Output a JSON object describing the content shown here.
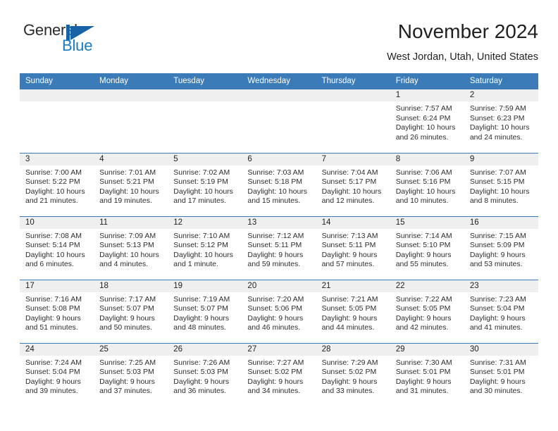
{
  "brand": {
    "name_part1": "General",
    "name_part2": "Blue",
    "logo_icon": "triangle-flag-icon",
    "accent_color": "#1763a6"
  },
  "header": {
    "month_title": "November 2024",
    "location": "West Jordan, Utah, United States"
  },
  "calendar": {
    "header_bg": "#3b7cb8",
    "daynum_bg": "#efefef",
    "weekday_headers": [
      "Sunday",
      "Monday",
      "Tuesday",
      "Wednesday",
      "Thursday",
      "Friday",
      "Saturday"
    ],
    "weeks": [
      [
        {
          "day": "",
          "empty": true,
          "sunrise": "",
          "sunset": "",
          "daylight1": "",
          "daylight2": ""
        },
        {
          "day": "",
          "empty": true,
          "sunrise": "",
          "sunset": "",
          "daylight1": "",
          "daylight2": ""
        },
        {
          "day": "",
          "empty": true,
          "sunrise": "",
          "sunset": "",
          "daylight1": "",
          "daylight2": ""
        },
        {
          "day": "",
          "empty": true,
          "sunrise": "",
          "sunset": "",
          "daylight1": "",
          "daylight2": ""
        },
        {
          "day": "",
          "empty": true,
          "sunrise": "",
          "sunset": "",
          "daylight1": "",
          "daylight2": ""
        },
        {
          "day": "1",
          "empty": false,
          "sunrise": "Sunrise: 7:57 AM",
          "sunset": "Sunset: 6:24 PM",
          "daylight1": "Daylight: 10 hours",
          "daylight2": "and 26 minutes."
        },
        {
          "day": "2",
          "empty": false,
          "sunrise": "Sunrise: 7:59 AM",
          "sunset": "Sunset: 6:23 PM",
          "daylight1": "Daylight: 10 hours",
          "daylight2": "and 24 minutes."
        }
      ],
      [
        {
          "day": "3",
          "empty": false,
          "sunrise": "Sunrise: 7:00 AM",
          "sunset": "Sunset: 5:22 PM",
          "daylight1": "Daylight: 10 hours",
          "daylight2": "and 21 minutes."
        },
        {
          "day": "4",
          "empty": false,
          "sunrise": "Sunrise: 7:01 AM",
          "sunset": "Sunset: 5:21 PM",
          "daylight1": "Daylight: 10 hours",
          "daylight2": "and 19 minutes."
        },
        {
          "day": "5",
          "empty": false,
          "sunrise": "Sunrise: 7:02 AM",
          "sunset": "Sunset: 5:19 PM",
          "daylight1": "Daylight: 10 hours",
          "daylight2": "and 17 minutes."
        },
        {
          "day": "6",
          "empty": false,
          "sunrise": "Sunrise: 7:03 AM",
          "sunset": "Sunset: 5:18 PM",
          "daylight1": "Daylight: 10 hours",
          "daylight2": "and 15 minutes."
        },
        {
          "day": "7",
          "empty": false,
          "sunrise": "Sunrise: 7:04 AM",
          "sunset": "Sunset: 5:17 PM",
          "daylight1": "Daylight: 10 hours",
          "daylight2": "and 12 minutes."
        },
        {
          "day": "8",
          "empty": false,
          "sunrise": "Sunrise: 7:06 AM",
          "sunset": "Sunset: 5:16 PM",
          "daylight1": "Daylight: 10 hours",
          "daylight2": "and 10 minutes."
        },
        {
          "day": "9",
          "empty": false,
          "sunrise": "Sunrise: 7:07 AM",
          "sunset": "Sunset: 5:15 PM",
          "daylight1": "Daylight: 10 hours",
          "daylight2": "and 8 minutes."
        }
      ],
      [
        {
          "day": "10",
          "empty": false,
          "sunrise": "Sunrise: 7:08 AM",
          "sunset": "Sunset: 5:14 PM",
          "daylight1": "Daylight: 10 hours",
          "daylight2": "and 6 minutes."
        },
        {
          "day": "11",
          "empty": false,
          "sunrise": "Sunrise: 7:09 AM",
          "sunset": "Sunset: 5:13 PM",
          "daylight1": "Daylight: 10 hours",
          "daylight2": "and 4 minutes."
        },
        {
          "day": "12",
          "empty": false,
          "sunrise": "Sunrise: 7:10 AM",
          "sunset": "Sunset: 5:12 PM",
          "daylight1": "Daylight: 10 hours",
          "daylight2": "and 1 minute."
        },
        {
          "day": "13",
          "empty": false,
          "sunrise": "Sunrise: 7:12 AM",
          "sunset": "Sunset: 5:11 PM",
          "daylight1": "Daylight: 9 hours",
          "daylight2": "and 59 minutes."
        },
        {
          "day": "14",
          "empty": false,
          "sunrise": "Sunrise: 7:13 AM",
          "sunset": "Sunset: 5:11 PM",
          "daylight1": "Daylight: 9 hours",
          "daylight2": "and 57 minutes."
        },
        {
          "day": "15",
          "empty": false,
          "sunrise": "Sunrise: 7:14 AM",
          "sunset": "Sunset: 5:10 PM",
          "daylight1": "Daylight: 9 hours",
          "daylight2": "and 55 minutes."
        },
        {
          "day": "16",
          "empty": false,
          "sunrise": "Sunrise: 7:15 AM",
          "sunset": "Sunset: 5:09 PM",
          "daylight1": "Daylight: 9 hours",
          "daylight2": "and 53 minutes."
        }
      ],
      [
        {
          "day": "17",
          "empty": false,
          "sunrise": "Sunrise: 7:16 AM",
          "sunset": "Sunset: 5:08 PM",
          "daylight1": "Daylight: 9 hours",
          "daylight2": "and 51 minutes."
        },
        {
          "day": "18",
          "empty": false,
          "sunrise": "Sunrise: 7:17 AM",
          "sunset": "Sunset: 5:07 PM",
          "daylight1": "Daylight: 9 hours",
          "daylight2": "and 50 minutes."
        },
        {
          "day": "19",
          "empty": false,
          "sunrise": "Sunrise: 7:19 AM",
          "sunset": "Sunset: 5:07 PM",
          "daylight1": "Daylight: 9 hours",
          "daylight2": "and 48 minutes."
        },
        {
          "day": "20",
          "empty": false,
          "sunrise": "Sunrise: 7:20 AM",
          "sunset": "Sunset: 5:06 PM",
          "daylight1": "Daylight: 9 hours",
          "daylight2": "and 46 minutes."
        },
        {
          "day": "21",
          "empty": false,
          "sunrise": "Sunrise: 7:21 AM",
          "sunset": "Sunset: 5:05 PM",
          "daylight1": "Daylight: 9 hours",
          "daylight2": "and 44 minutes."
        },
        {
          "day": "22",
          "empty": false,
          "sunrise": "Sunrise: 7:22 AM",
          "sunset": "Sunset: 5:05 PM",
          "daylight1": "Daylight: 9 hours",
          "daylight2": "and 42 minutes."
        },
        {
          "day": "23",
          "empty": false,
          "sunrise": "Sunrise: 7:23 AM",
          "sunset": "Sunset: 5:04 PM",
          "daylight1": "Daylight: 9 hours",
          "daylight2": "and 41 minutes."
        }
      ],
      [
        {
          "day": "24",
          "empty": false,
          "sunrise": "Sunrise: 7:24 AM",
          "sunset": "Sunset: 5:04 PM",
          "daylight1": "Daylight: 9 hours",
          "daylight2": "and 39 minutes."
        },
        {
          "day": "25",
          "empty": false,
          "sunrise": "Sunrise: 7:25 AM",
          "sunset": "Sunset: 5:03 PM",
          "daylight1": "Daylight: 9 hours",
          "daylight2": "and 37 minutes."
        },
        {
          "day": "26",
          "empty": false,
          "sunrise": "Sunrise: 7:26 AM",
          "sunset": "Sunset: 5:03 PM",
          "daylight1": "Daylight: 9 hours",
          "daylight2": "and 36 minutes."
        },
        {
          "day": "27",
          "empty": false,
          "sunrise": "Sunrise: 7:27 AM",
          "sunset": "Sunset: 5:02 PM",
          "daylight1": "Daylight: 9 hours",
          "daylight2": "and 34 minutes."
        },
        {
          "day": "28",
          "empty": false,
          "sunrise": "Sunrise: 7:29 AM",
          "sunset": "Sunset: 5:02 PM",
          "daylight1": "Daylight: 9 hours",
          "daylight2": "and 33 minutes."
        },
        {
          "day": "29",
          "empty": false,
          "sunrise": "Sunrise: 7:30 AM",
          "sunset": "Sunset: 5:01 PM",
          "daylight1": "Daylight: 9 hours",
          "daylight2": "and 31 minutes."
        },
        {
          "day": "30",
          "empty": false,
          "sunrise": "Sunrise: 7:31 AM",
          "sunset": "Sunset: 5:01 PM",
          "daylight1": "Daylight: 9 hours",
          "daylight2": "and 30 minutes."
        }
      ]
    ]
  }
}
